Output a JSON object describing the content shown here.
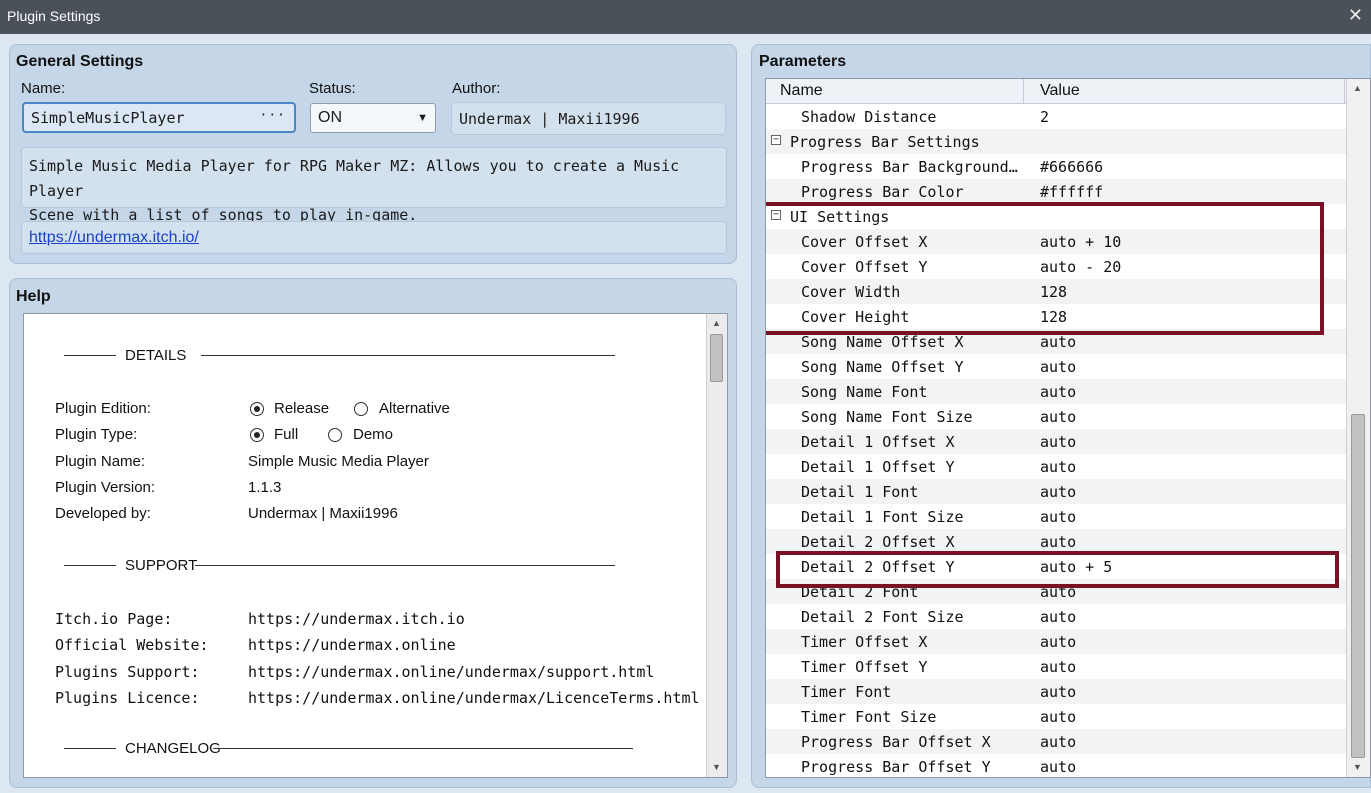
{
  "window": {
    "title": "Plugin Settings",
    "close": "✕"
  },
  "general": {
    "title": "General Settings",
    "name_label": "Name:",
    "name_value": "SimpleMusicPlayer",
    "name_button": "···",
    "status_label": "Status:",
    "status_value": "ON",
    "author_label": "Author:",
    "author_value": "Undermax | Maxii1996",
    "description_line1": "Simple Music Media Player for RPG Maker MZ: Allows you to create a Music Player",
    "description_line2": "Scene with a list of songs to play in-game.",
    "url": "https://undermax.itch.io/"
  },
  "help": {
    "title": "Help",
    "details_heading": "DETAILS",
    "edition_label": "Plugin Edition:",
    "edition_options": [
      "Release",
      "Alternative"
    ],
    "edition_selected": "Release",
    "type_label": "Plugin Type:",
    "type_options": [
      "Full",
      "Demo"
    ],
    "type_selected": "Full",
    "name_label": "Plugin Name:",
    "name_value": "Simple Music Media Player",
    "version_label": "Plugin Version:",
    "version_value": "1.1.3",
    "dev_label": "Developed by:",
    "dev_value": "Undermax | Maxii1996",
    "support_heading": "SUPPORT",
    "itch_label": "Itch.io Page:",
    "itch_value": "https://undermax.itch.io",
    "website_label": "Official Website:",
    "website_value": "https://undermax.online",
    "support_label": "Plugins Support:",
    "support_value": "https://undermax.online/undermax/support.html",
    "licence_label": "Plugins Licence:",
    "licence_value": "https://undermax.online/undermax/LicenceTerms.html",
    "changelog_heading": "CHANGELOG"
  },
  "parameters": {
    "title": "Parameters",
    "col_name": "Name",
    "col_value": "Value",
    "rows": [
      {
        "name": "Shadow Distance",
        "value": "2",
        "group": false
      },
      {
        "name": "Progress Bar Settings",
        "value": "",
        "group": true
      },
      {
        "name": "Progress Bar Background…",
        "value": "#666666",
        "group": false
      },
      {
        "name": "Progress Bar Color",
        "value": "#ffffff",
        "group": false
      },
      {
        "name": "UI Settings",
        "value": "",
        "group": true
      },
      {
        "name": "Cover Offset X",
        "value": "auto + 10",
        "group": false
      },
      {
        "name": "Cover Offset Y",
        "value": "auto - 20",
        "group": false
      },
      {
        "name": "Cover Width",
        "value": "128",
        "group": false
      },
      {
        "name": "Cover Height",
        "value": "128",
        "group": false
      },
      {
        "name": "Song Name Offset X",
        "value": "auto",
        "group": false
      },
      {
        "name": "Song Name Offset Y",
        "value": "auto",
        "group": false
      },
      {
        "name": "Song Name Font",
        "value": "auto",
        "group": false
      },
      {
        "name": "Song Name Font Size",
        "value": "auto",
        "group": false
      },
      {
        "name": "Detail 1 Offset X",
        "value": "auto",
        "group": false
      },
      {
        "name": "Detail 1 Offset Y",
        "value": "auto",
        "group": false
      },
      {
        "name": "Detail 1 Font",
        "value": "auto",
        "group": false
      },
      {
        "name": "Detail 1 Font Size",
        "value": "auto",
        "group": false
      },
      {
        "name": "Detail 2 Offset X",
        "value": "auto",
        "group": false
      },
      {
        "name": "Detail 2 Offset Y",
        "value": "auto + 5",
        "group": false
      },
      {
        "name": "Detail 2 Font",
        "value": "auto",
        "group": false
      },
      {
        "name": "Detail 2 Font Size",
        "value": "auto",
        "group": false
      },
      {
        "name": "Timer Offset X",
        "value": "auto",
        "group": false
      },
      {
        "name": "Timer Offset Y",
        "value": "auto",
        "group": false
      },
      {
        "name": "Timer Font",
        "value": "auto",
        "group": false
      },
      {
        "name": "Timer Font Size",
        "value": "auto",
        "group": false
      },
      {
        "name": "Progress Bar Offset X",
        "value": "auto",
        "group": false
      },
      {
        "name": "Progress Bar Offset Y",
        "value": "auto",
        "group": false
      }
    ]
  },
  "colors": {
    "highlight": "#7a1023",
    "link": "#1a43c4"
  }
}
